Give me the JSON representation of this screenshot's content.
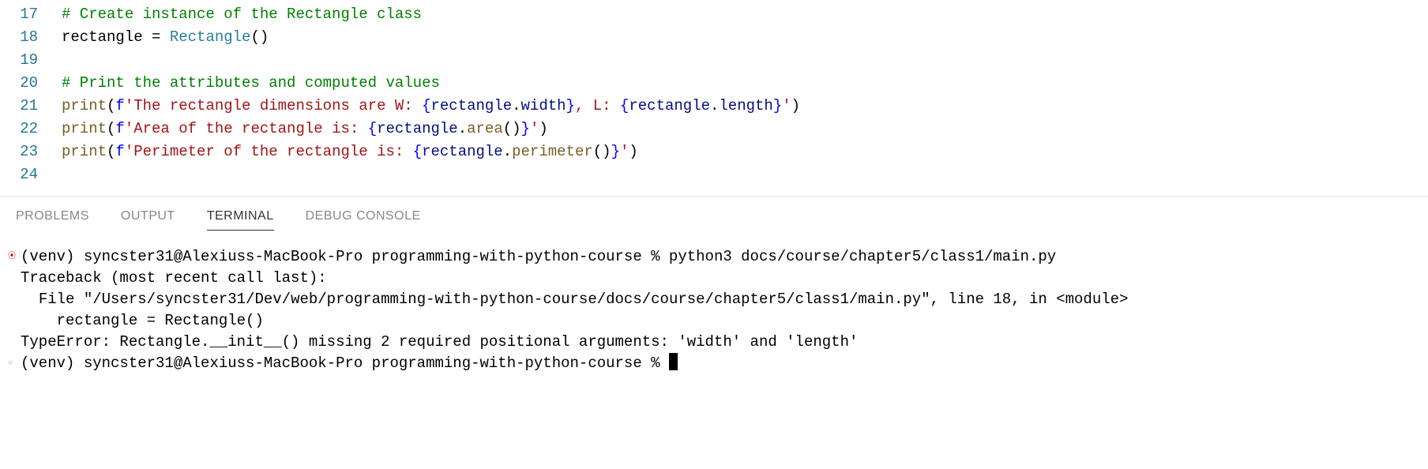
{
  "chart_data": null,
  "editor": {
    "lines": [
      {
        "num": "17",
        "tokens": [
          {
            "cls": "comment",
            "t": "# Create instance of the Rectangle class"
          }
        ]
      },
      {
        "num": "18",
        "tokens": [
          {
            "cls": "identifier",
            "t": "rectangle "
          },
          {
            "cls": "operator",
            "t": "="
          },
          {
            "cls": "identifier",
            "t": " "
          },
          {
            "cls": "class-name",
            "t": "Rectangle"
          },
          {
            "cls": "punct",
            "t": "()"
          }
        ]
      },
      {
        "num": "19",
        "tokens": []
      },
      {
        "num": "20",
        "tokens": [
          {
            "cls": "comment",
            "t": "# Print the attributes and computed values"
          }
        ]
      },
      {
        "num": "21",
        "tokens": [
          {
            "cls": "function",
            "t": "print"
          },
          {
            "cls": "punct",
            "t": "("
          },
          {
            "cls": "fstring-expr",
            "t": "f"
          },
          {
            "cls": "string",
            "t": "'The rectangle dimensions are W: "
          },
          {
            "cls": "fstring-expr",
            "t": "{"
          },
          {
            "cls": "attr",
            "t": "rectangle"
          },
          {
            "cls": "punct",
            "t": "."
          },
          {
            "cls": "attr",
            "t": "width"
          },
          {
            "cls": "fstring-expr",
            "t": "}"
          },
          {
            "cls": "string",
            "t": ", L: "
          },
          {
            "cls": "fstring-expr",
            "t": "{"
          },
          {
            "cls": "attr",
            "t": "rectangle"
          },
          {
            "cls": "punct",
            "t": "."
          },
          {
            "cls": "attr",
            "t": "length"
          },
          {
            "cls": "fstring-expr",
            "t": "}"
          },
          {
            "cls": "string",
            "t": "'"
          },
          {
            "cls": "punct",
            "t": ")"
          }
        ]
      },
      {
        "num": "22",
        "tokens": [
          {
            "cls": "function",
            "t": "print"
          },
          {
            "cls": "punct",
            "t": "("
          },
          {
            "cls": "fstring-expr",
            "t": "f"
          },
          {
            "cls": "string",
            "t": "'Area of the rectangle is: "
          },
          {
            "cls": "fstring-expr",
            "t": "{"
          },
          {
            "cls": "attr",
            "t": "rectangle"
          },
          {
            "cls": "punct",
            "t": "."
          },
          {
            "cls": "method",
            "t": "area"
          },
          {
            "cls": "punct",
            "t": "()"
          },
          {
            "cls": "fstring-expr",
            "t": "}"
          },
          {
            "cls": "string",
            "t": "'"
          },
          {
            "cls": "punct",
            "t": ")"
          }
        ]
      },
      {
        "num": "23",
        "tokens": [
          {
            "cls": "function",
            "t": "print"
          },
          {
            "cls": "punct",
            "t": "("
          },
          {
            "cls": "fstring-expr",
            "t": "f"
          },
          {
            "cls": "string",
            "t": "'Perimeter of the rectangle is: "
          },
          {
            "cls": "fstring-expr",
            "t": "{"
          },
          {
            "cls": "attr",
            "t": "rectangle"
          },
          {
            "cls": "punct",
            "t": "."
          },
          {
            "cls": "method",
            "t": "perimeter"
          },
          {
            "cls": "punct",
            "t": "()"
          },
          {
            "cls": "fstring-expr",
            "t": "}"
          },
          {
            "cls": "string",
            "t": "'"
          },
          {
            "cls": "punct",
            "t": ")"
          }
        ]
      },
      {
        "num": "24",
        "tokens": []
      }
    ]
  },
  "panel": {
    "tabs": {
      "problems": "PROBLEMS",
      "output": "OUTPUT",
      "terminal": "TERMINAL",
      "debug_console": "DEBUG CONSOLE"
    },
    "active": "terminal"
  },
  "terminal": {
    "lines": [
      {
        "bullet": "red",
        "text": "(venv) syncster31@Alexiuss-MacBook-Pro programming-with-python-course % python3 docs/course/chapter5/class1/main.py"
      },
      {
        "bullet": "",
        "text": "Traceback (most recent call last):"
      },
      {
        "bullet": "",
        "text": "  File \"/Users/syncster31/Dev/web/programming-with-python-course/docs/course/chapter5/class1/main.py\", line 18, in <module>"
      },
      {
        "bullet": "",
        "text": "    rectangle = Rectangle()"
      },
      {
        "bullet": "",
        "text": "TypeError: Rectangle.__init__() missing 2 required positional arguments: 'width' and 'length'"
      },
      {
        "bullet": "gray",
        "text": "(venv) syncster31@Alexiuss-MacBook-Pro programming-with-python-course % ",
        "cursor": true
      }
    ]
  }
}
